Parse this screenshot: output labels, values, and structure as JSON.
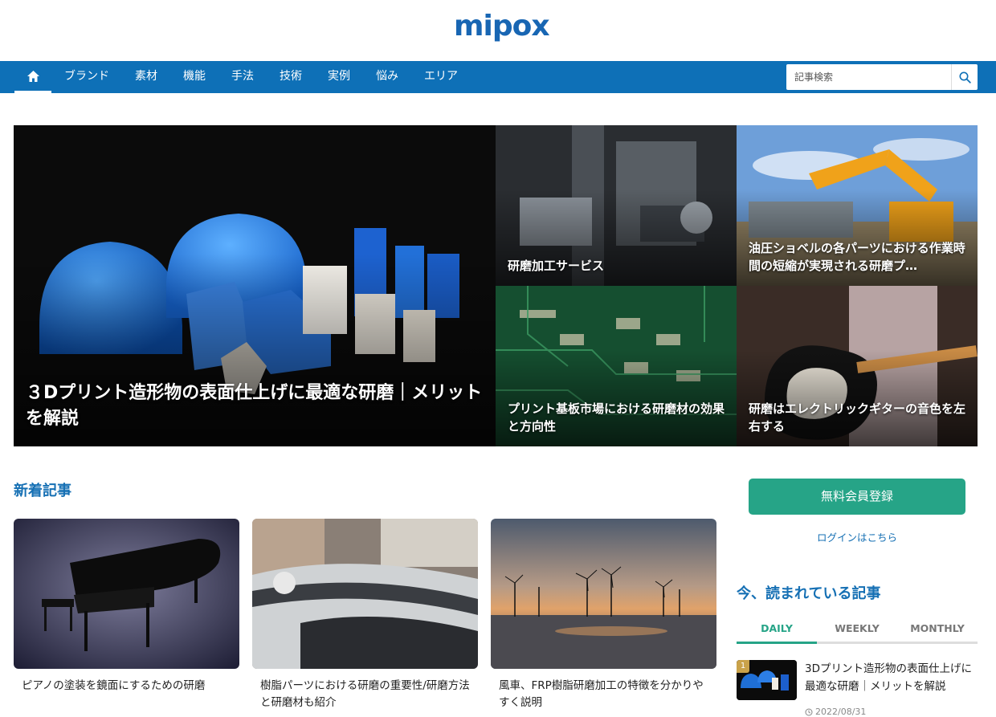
{
  "site": {
    "logo": "mipox"
  },
  "nav": {
    "items": [
      "ブランド",
      "素材",
      "機能",
      "手法",
      "技術",
      "実例",
      "悩み",
      "エリア"
    ],
    "search_placeholder": "記事検索"
  },
  "hero": {
    "main": {
      "title": "３Dプリント造形物の表面仕上げに最適な研磨｜メリットを解説"
    },
    "tiles": [
      {
        "title": "研磨加工サービス"
      },
      {
        "title": "油圧ショベルの各パーツにおける作業時間の短縮が実現される研磨プ…"
      },
      {
        "title": "プリント基板市場における研磨材の効果と方向性"
      },
      {
        "title": "研磨はエレクトリックギターの音色を左右する"
      }
    ]
  },
  "new_articles": {
    "heading": "新着記事",
    "cards": [
      {
        "title": "ピアノの塗装を鏡面にするための研磨"
      },
      {
        "title": "樹脂パーツにおける研磨の重要性/研磨方法と研磨材も紹介"
      },
      {
        "title": "風車、FRP樹脂研磨加工の特徴を分かりやすく説明"
      }
    ]
  },
  "sidebar": {
    "signup_label": "無料会員登録",
    "login_label": "ログインはこちら",
    "popular_heading": "今、読まれている記事",
    "tabs": [
      "DAILY",
      "WEEKLY",
      "MONTHLY"
    ],
    "active_tab": "DAILY",
    "ranking": [
      {
        "rank": "1",
        "title": "3Dプリント造形物の表面仕上げに最適な研磨｜メリットを解説",
        "date": "2022/08/31"
      }
    ]
  },
  "colors": {
    "brand_blue": "#0e70b7",
    "accent_green": "#26a487",
    "rank_gold": "#c9a24a"
  }
}
